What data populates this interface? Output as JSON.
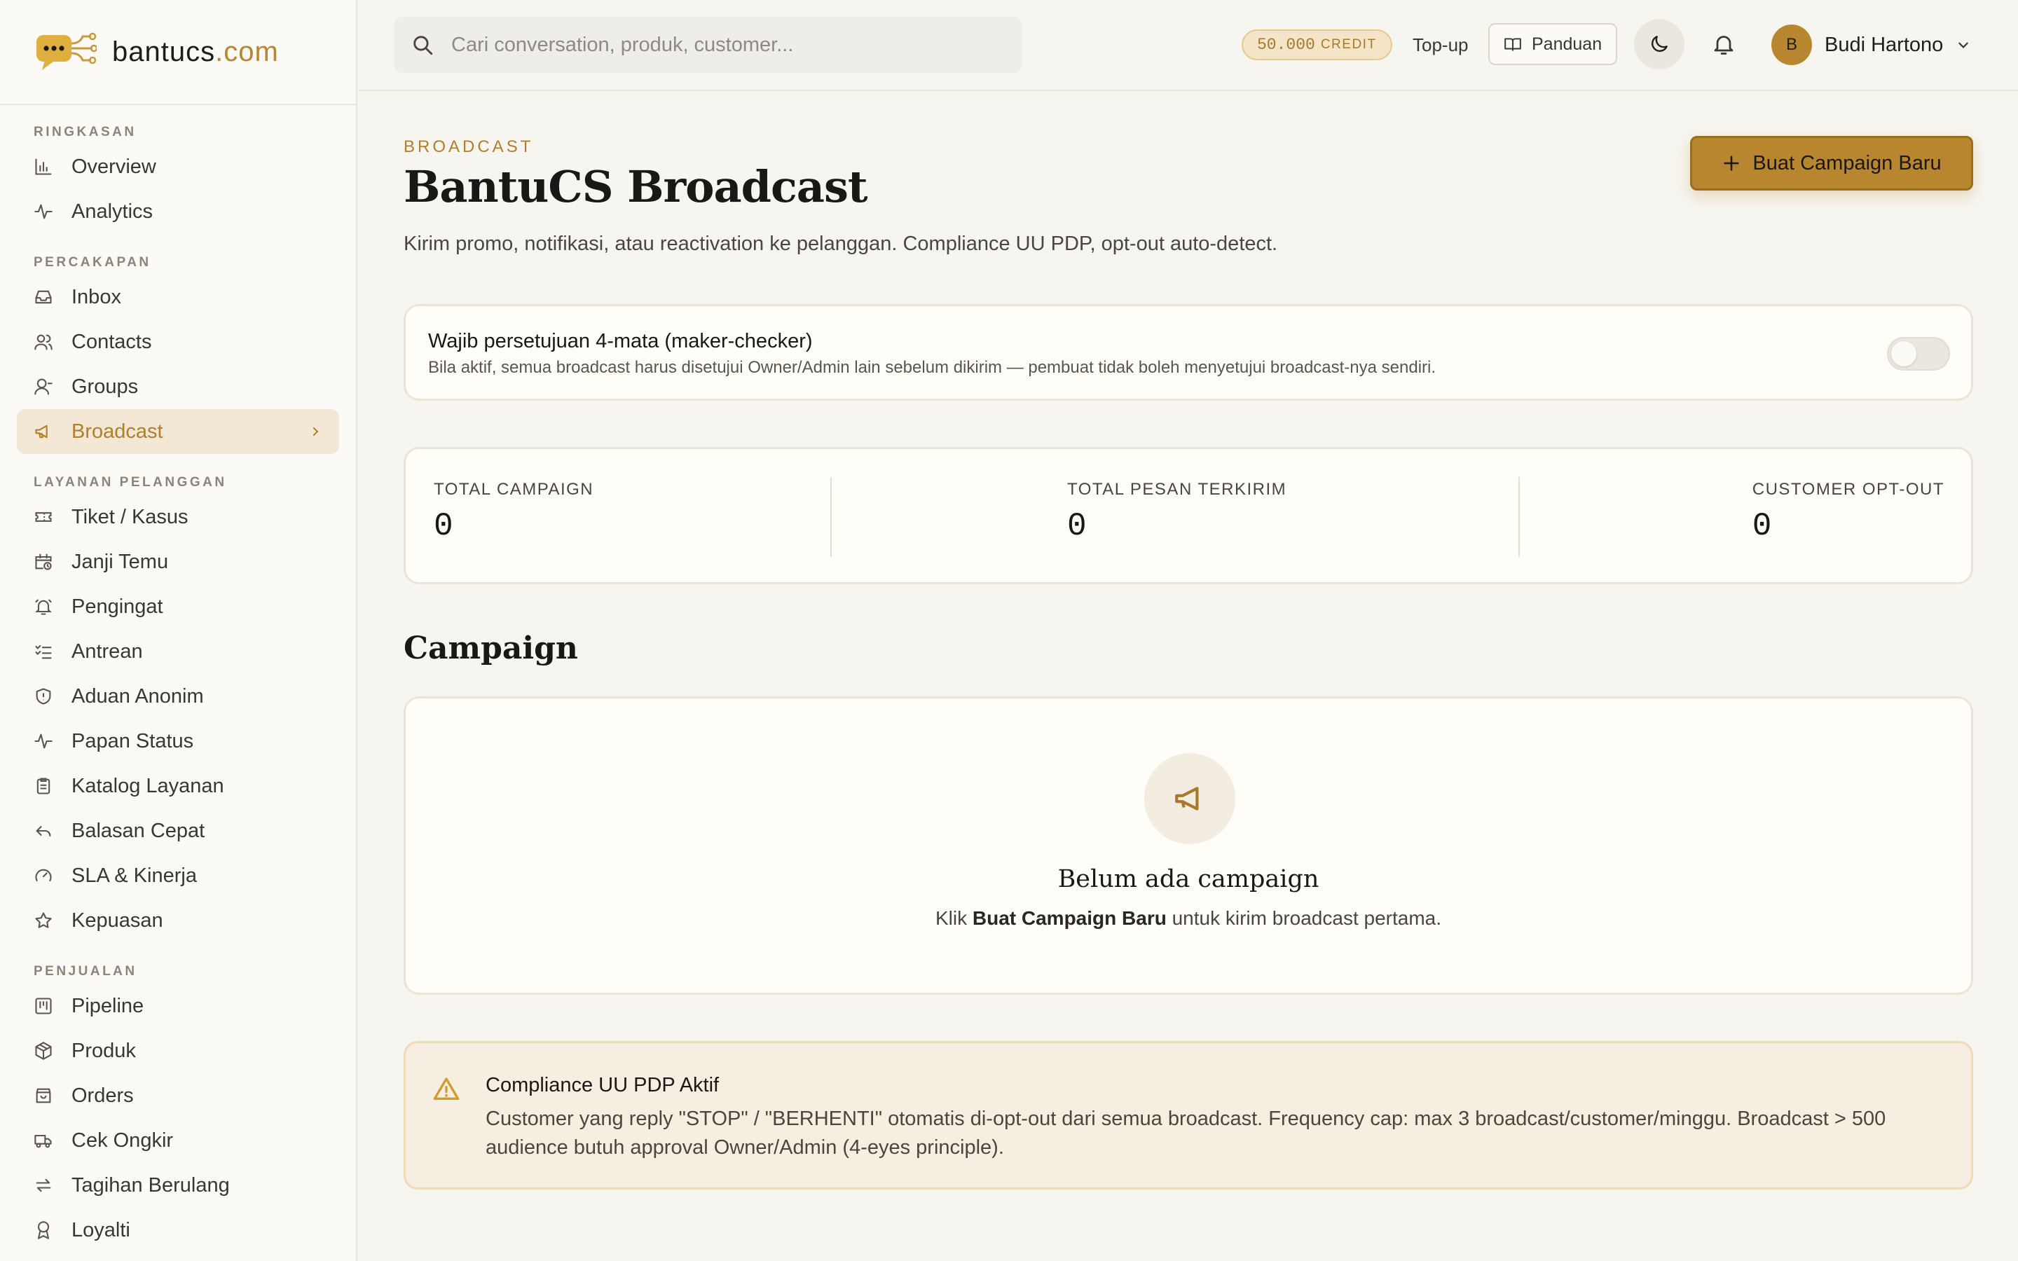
{
  "brand": {
    "name": "bantucs",
    "tld": ".com"
  },
  "sidebar": {
    "sections": [
      {
        "title": "RINGKASAN",
        "items": [
          {
            "label": "Overview",
            "icon": "bar-chart-icon"
          },
          {
            "label": "Analytics",
            "icon": "activity-icon"
          }
        ]
      },
      {
        "title": "PERCAKAPAN",
        "items": [
          {
            "label": "Inbox",
            "icon": "inbox-icon"
          },
          {
            "label": "Contacts",
            "icon": "users-icon"
          },
          {
            "label": "Groups",
            "icon": "user-group-icon"
          },
          {
            "label": "Broadcast",
            "icon": "megaphone-icon",
            "active": true
          }
        ]
      },
      {
        "title": "LAYANAN PELANGGAN",
        "items": [
          {
            "label": "Tiket / Kasus",
            "icon": "ticket-icon"
          },
          {
            "label": "Janji Temu",
            "icon": "calendar-clock-icon"
          },
          {
            "label": "Pengingat",
            "icon": "bell-ring-icon"
          },
          {
            "label": "Antrean",
            "icon": "list-checks-icon"
          },
          {
            "label": "Aduan Anonim",
            "icon": "shield-icon"
          },
          {
            "label": "Papan Status",
            "icon": "pulse-icon"
          },
          {
            "label": "Katalog Layanan",
            "icon": "clipboard-icon"
          },
          {
            "label": "Balasan Cepat",
            "icon": "reply-icon"
          },
          {
            "label": "SLA & Kinerja",
            "icon": "gauge-icon"
          },
          {
            "label": "Kepuasan",
            "icon": "star-icon"
          }
        ]
      },
      {
        "title": "PENJUALAN",
        "items": [
          {
            "label": "Pipeline",
            "icon": "kanban-icon"
          },
          {
            "label": "Produk",
            "icon": "package-icon"
          },
          {
            "label": "Orders",
            "icon": "shopping-bag-icon"
          },
          {
            "label": "Cek Ongkir",
            "icon": "truck-icon"
          },
          {
            "label": "Tagihan Berulang",
            "icon": "repeat-icon"
          },
          {
            "label": "Loyalti",
            "icon": "award-icon"
          }
        ]
      }
    ]
  },
  "topbar": {
    "search_placeholder": "Cari conversation, produk, customer...",
    "credit_amount": "50.000",
    "credit_label": "CREDIT",
    "topup_label": "Top-up",
    "panduan_label": "Panduan",
    "user_initial": "B",
    "user_name": "Budi Hartono"
  },
  "header": {
    "eyebrow": "BROADCAST",
    "title": "BantuCS Broadcast",
    "subtitle": "Kirim promo, notifikasi, atau reactivation ke pelanggan. Compliance UU PDP, opt-out auto-detect.",
    "create_button": "Buat Campaign Baru"
  },
  "approval": {
    "title": "Wajib persetujuan 4-mata (maker-checker)",
    "description": "Bila aktif, semua broadcast harus disetujui Owner/Admin lain sebelum dikirim — pembuat tidak boleh menyetujui broadcast-nya sendiri.",
    "enabled": false
  },
  "stats": [
    {
      "label": "TOTAL CAMPAIGN",
      "value": "0"
    },
    {
      "label": "TOTAL PESAN TERKIRIM",
      "value": "0"
    },
    {
      "label": "CUSTOMER OPT-OUT",
      "value": "0"
    }
  ],
  "campaign": {
    "section_title": "Campaign",
    "empty_title": "Belum ada campaign",
    "empty_prefix": "Klik ",
    "empty_bold": "Buat Campaign Baru",
    "empty_suffix": " untuk kirim broadcast pertama."
  },
  "notice": {
    "title": "Compliance UU PDP Aktif",
    "text": "Customer yang reply \"STOP\" / \"BERHENTI\" otomatis di-opt-out dari semua broadcast. Frequency cap: max 3 broadcast/customer/minggu. Broadcast > 500 audience butuh approval Owner/Admin (4-eyes principle)."
  },
  "colors": {
    "accent": "#b8862e",
    "background": "#f7f5f0",
    "card": "#fffdf7",
    "active_nav_bg": "#f3e7d6"
  }
}
